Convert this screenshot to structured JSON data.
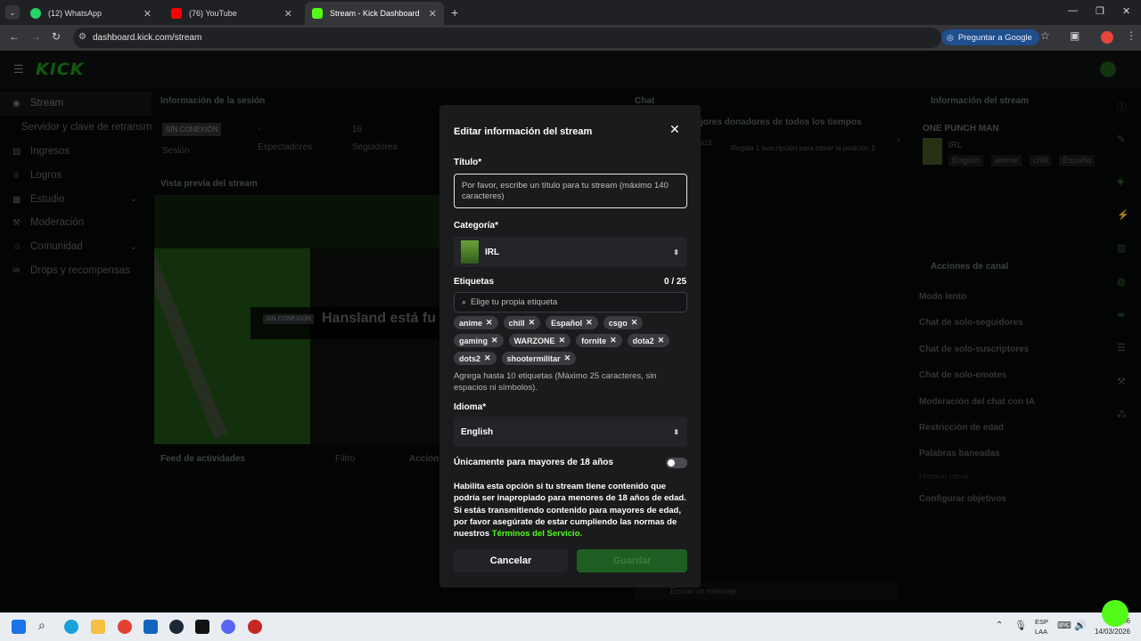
{
  "browser": {
    "tabs": [
      {
        "label": "(12) WhatsApp",
        "badge": "12"
      },
      {
        "label": "(76) YouTube"
      },
      {
        "label": "Stream - Kick Dashboard"
      }
    ],
    "url": "dashboard.kick.com/stream",
    "google_button": "Preguntar a Google"
  },
  "brand": {
    "logo": "KICK"
  },
  "sidebar": {
    "items": [
      {
        "label": "Stream",
        "icon": "broadcast-icon"
      },
      {
        "label": "Servidor y clave de retransm",
        "icon": ""
      },
      {
        "label": "Ingresos",
        "icon": "chart-icon"
      },
      {
        "label": "Logros",
        "icon": "trophy-icon"
      },
      {
        "label": "Estudio",
        "icon": "grid-icon"
      },
      {
        "label": "Moderación",
        "icon": "hammer-icon"
      },
      {
        "label": "Comunidad",
        "icon": "people-icon"
      },
      {
        "label": "Drops y recompensas",
        "icon": "gift-icon"
      }
    ]
  },
  "session": {
    "title": "Información de la sesión",
    "offline_badge": "SIN CONEXIÓN",
    "session_label": "Sesión",
    "viewers_value": "-",
    "viewers_label": "Espectadores",
    "followers_value": "16",
    "followers_label": "Seguidores"
  },
  "preview": {
    "title": "Vista previa del stream",
    "offline_badge": "SIN CONEXIÓN",
    "offline_text": "Hansland está fu"
  },
  "activity": {
    "title": "Feed de actividades",
    "filter": "Filtro",
    "actions": "Accion"
  },
  "chat": {
    "title": "Chat",
    "donors_title": "jores donadores de todos los tiempos",
    "donors_hint": "Regala 1 suscripción para tomar la posición 2",
    "rank_fragment": "s15",
    "input_placeholder": "Enviar un mensaje"
  },
  "stream_info": {
    "title": "Información del stream",
    "stream_title": "ONE PUNCH MAN",
    "category": "IRL",
    "tags": [
      "English",
      "anime",
      "chill",
      "Españo"
    ]
  },
  "channel_actions": {
    "title": "Acciones de canal",
    "items": [
      "Modo lento",
      "Chat de solo-seguidores",
      "Chat de solo-suscriptores",
      "Chat de solo-emotes",
      "Moderación del chat con IA",
      "Restricción de edad",
      "Palabras baneadas",
      "Hostear canal",
      "Configurar objetivos"
    ]
  },
  "modal": {
    "title": "Editar información del stream",
    "title_label": "Título*",
    "title_placeholder": "Por favor, escribe un título para tu stream (máximo 140 caracteres)",
    "category_label": "Categoría*",
    "category_value": "IRL",
    "tags_label": "Etiquetas",
    "tags_count": "0 / 25",
    "tags_placeholder": "Elige tu propia etiqueta",
    "tags": [
      "anime",
      "chill",
      "Español",
      "csgo",
      "gaming",
      "WARZONE",
      "fornite",
      "dota2",
      "dots2",
      "shootermilitar"
    ],
    "tags_hint": "Agrega hasta 10 etiquetas (Máximo 25 caracteres, sin espacios ni símbolos).",
    "language_label": "Idioma*",
    "language_value": "English",
    "adult_label": "Únicamente para mayores de 18 años",
    "adult_text": "Habilita esta opción si tu stream tiene contenido que podría ser inapropiado para menores de 18 años de edad. Si estás transmitiendo contenido para mayores de edad, por favor asegúrate de estar cumpliendo las normas de nuestros",
    "terms_link": "Términos del Servicio.",
    "adult_enabled": false,
    "cancel": "Cancelar",
    "save": "Guardar"
  },
  "taskbar": {
    "lang_top": "ESP",
    "lang_bottom": "LAA",
    "time": "00:46",
    "date": "14/03/2026"
  },
  "colors": {
    "accent": "#53fc18",
    "save_bg": "#1f5e22",
    "kick_dim": "#1b8a17"
  }
}
